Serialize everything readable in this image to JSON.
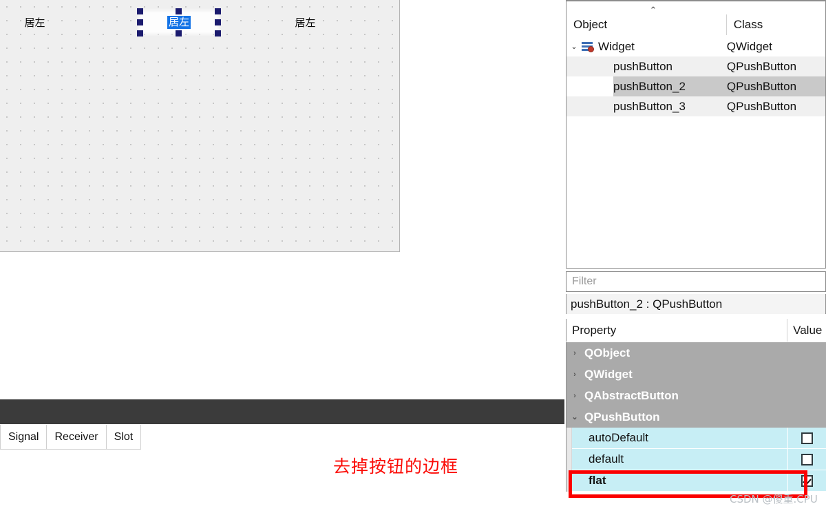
{
  "canvas": {
    "buttons": [
      {
        "name": "pushButton",
        "text": "居左",
        "selected": false
      },
      {
        "name": "pushButton_2",
        "text": "居左",
        "selected": true
      },
      {
        "name": "pushButton_3",
        "text": "居左",
        "selected": false
      }
    ]
  },
  "signal_slot_editor": {
    "columns": [
      "Signal",
      "Receiver",
      "Slot"
    ],
    "rows": []
  },
  "annotation": {
    "text": "去掉按钮的边框",
    "color": "#fb0b06"
  },
  "object_inspector": {
    "sort_indicator": "⌃",
    "columns": {
      "object": "Object",
      "class": "Class"
    },
    "rows": [
      {
        "object": "Widget",
        "class": "QWidget",
        "level": 0,
        "expander": "⌄",
        "icon": "widget-form-icon",
        "selected": false,
        "alt": false
      },
      {
        "object": "pushButton",
        "class": "QPushButton",
        "level": 1,
        "expander": "",
        "icon": "",
        "selected": false,
        "alt": true
      },
      {
        "object": "pushButton_2",
        "class": "QPushButton",
        "level": 1,
        "expander": "",
        "icon": "",
        "selected": true,
        "alt": false
      },
      {
        "object": "pushButton_3",
        "class": "QPushButton",
        "level": 1,
        "expander": "",
        "icon": "",
        "selected": false,
        "alt": true
      }
    ]
  },
  "property_editor": {
    "filter_placeholder": "Filter",
    "filter_value": "",
    "target": "pushButton_2 : QPushButton",
    "columns": {
      "property": "Property",
      "value": "Value"
    },
    "groups": [
      {
        "label": "QObject",
        "expander": "›",
        "expanded": false
      },
      {
        "label": "QWidget",
        "expander": "›",
        "expanded": false
      },
      {
        "label": "QAbstractButton",
        "expander": "›",
        "expanded": false
      },
      {
        "label": "QPushButton",
        "expander": "⌄",
        "expanded": true
      }
    ],
    "properties": [
      {
        "name": "autoDefault",
        "checked": false,
        "bold": false,
        "highlighted": false
      },
      {
        "name": "default",
        "checked": false,
        "bold": false,
        "highlighted": false
      },
      {
        "name": "flat",
        "checked": true,
        "bold": true,
        "highlighted": true
      }
    ]
  },
  "watermark": {
    "text": "CSDN @傻重.CPU"
  }
}
